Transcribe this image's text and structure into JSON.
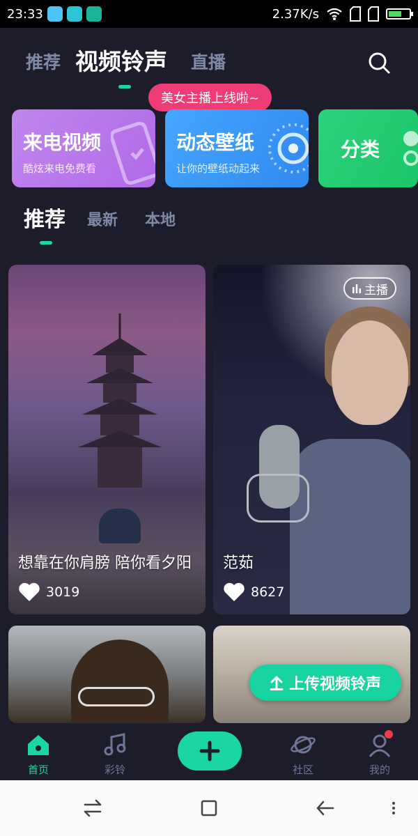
{
  "status_bar": {
    "time": "23:33",
    "net_speed": "2.37K/s"
  },
  "top_nav": {
    "tabs": [
      {
        "label": "推荐"
      },
      {
        "label": "视频铃声"
      },
      {
        "label": "直播"
      }
    ],
    "active_index": 1,
    "live_bubble": "美女主播上线啦~"
  },
  "features": [
    {
      "title": "来电视频",
      "subtitle": "酷炫来电免费看"
    },
    {
      "title": "动态壁纸",
      "subtitle": "让你的壁纸动起来"
    },
    {
      "title": "分类"
    }
  ],
  "sub_tabs": [
    {
      "label": "推荐"
    },
    {
      "label": "最新"
    },
    {
      "label": "本地"
    }
  ],
  "videos": [
    {
      "title": "想靠在你肩膀 陪你看夕阳",
      "likes": "3019"
    },
    {
      "title": "范茹",
      "likes": "8627",
      "tag": "主播"
    },
    {
      "title": ""
    },
    {
      "title": ""
    }
  ],
  "upload_label": "上传视频铃声",
  "bottom_nav": [
    {
      "label": "首页",
      "icon": "home-icon"
    },
    {
      "label": "彩铃",
      "icon": "music-icon"
    },
    {
      "label": "",
      "icon": "plus-icon"
    },
    {
      "label": "社区",
      "icon": "planet-icon"
    },
    {
      "label": "我的",
      "icon": "profile-icon"
    }
  ],
  "colors": {
    "accent": "#19d6a3",
    "background": "#1c1c2b",
    "bubble": "#ee3d76"
  }
}
